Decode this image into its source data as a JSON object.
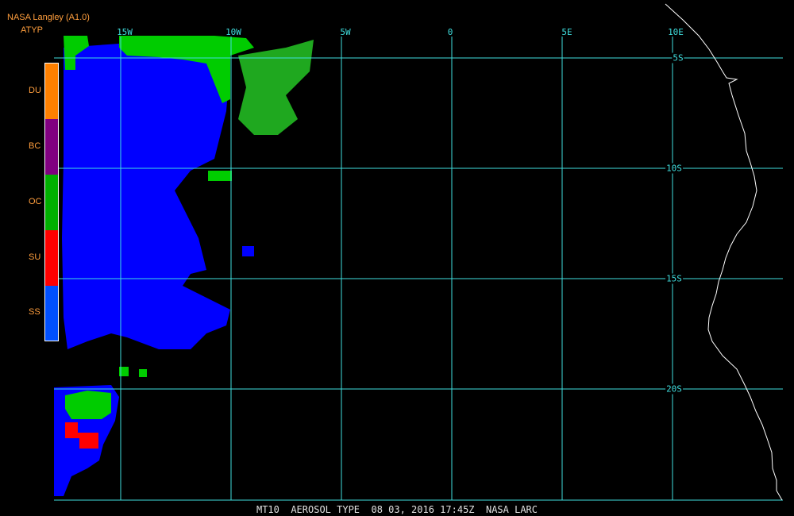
{
  "header": {
    "source": "NASA Langley (A1.0)",
    "product": "ATYP"
  },
  "legend": {
    "items": [
      {
        "label": "DU",
        "color": "#ff8000"
      },
      {
        "label": "BC",
        "color": "#800080"
      },
      {
        "label": "OC",
        "color": "#00b000"
      },
      {
        "label": "SU",
        "color": "#ff0000"
      },
      {
        "label": "SS",
        "color": "#0050ff"
      }
    ]
  },
  "grid": {
    "color": "#3fdede",
    "longitudes": [
      {
        "label": "15W",
        "value": -15
      },
      {
        "label": "10W",
        "value": -10
      },
      {
        "label": "5W",
        "value": -5
      },
      {
        "label": "0",
        "value": 0
      },
      {
        "label": "5E",
        "value": 5
      },
      {
        "label": "10E",
        "value": 10
      }
    ],
    "latitudes": [
      {
        "label": "5S",
        "value": -5
      },
      {
        "label": "10S",
        "value": -10
      },
      {
        "label": "15S",
        "value": -15
      },
      {
        "label": "20S",
        "value": -20
      }
    ]
  },
  "footer": {
    "caption": "MT10  AEROSOL TYPE  08 03, 2016 17:45Z  NASA LARC"
  },
  "colors": {
    "coastline": "#ffffff",
    "ss": "#0000ff",
    "oc": "#00cc00",
    "su": "#ff0000",
    "background": "#000000"
  }
}
